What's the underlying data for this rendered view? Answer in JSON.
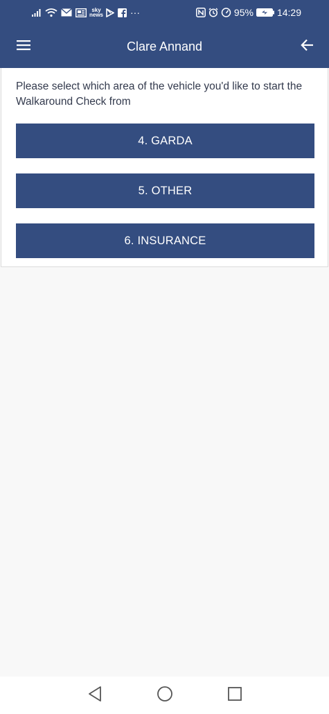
{
  "status_bar": {
    "battery_percent": "95%",
    "time": "14:29",
    "sky_news_label": "sky news",
    "overflow": "···",
    "icons": [
      "signal-icon",
      "wifi-icon",
      "mail-icon",
      "news-icon",
      "sky-news-icon",
      "play-store-icon",
      "facebook-icon",
      "nfc-icon",
      "alarm-icon",
      "speed-icon",
      "battery-icon"
    ]
  },
  "app_bar": {
    "title": "Clare Annand",
    "icons": [
      "hamburger-menu-icon",
      "back-arrow-icon"
    ]
  },
  "content": {
    "prompt": "Please select which area of the vehicle you'd like to start the Walkaround Check from",
    "options": [
      {
        "label": "4. GARDA"
      },
      {
        "label": "5. OTHER"
      },
      {
        "label": "6. INSURANCE"
      }
    ]
  },
  "nav_bar": {
    "icons": [
      "back-triangle-icon",
      "home-circle-icon",
      "recents-square-icon"
    ]
  },
  "colors": {
    "primary": "#344d80",
    "background": "#f8f8f8",
    "card": "#ffffff",
    "text": "#333a4d"
  }
}
